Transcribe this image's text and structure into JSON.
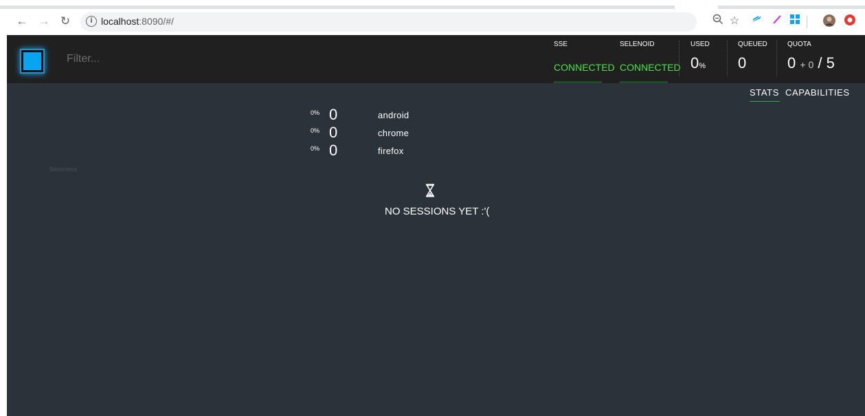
{
  "browser": {
    "url_host": "localhost",
    "url_path": ":8090/#/",
    "info_glyph": "i",
    "icons": [
      "back-icon",
      "forward-icon",
      "reload-icon",
      "zoom-icon",
      "bookmark-star-icon",
      "extension-feather-icon",
      "extension-pen-icon",
      "extension-windows-icon",
      "profile-avatar-icon",
      "extension-red-icon"
    ]
  },
  "app": {
    "filter_placeholder": "Filter...",
    "colors": {
      "background": "#2c323a",
      "topbar": "#202020",
      "connected": "#4be34b",
      "accent": "#09a4ef"
    },
    "stats": {
      "sse": {
        "label": "SSE",
        "value": "CONNECTED"
      },
      "selenoid": {
        "label": "SELENOID",
        "value": "CONNECTED"
      },
      "used": {
        "label": "USED",
        "value": "0",
        "unit": "%"
      },
      "queued": {
        "label": "QUEUED",
        "value": "0"
      },
      "quota": {
        "label": "QUOTA",
        "used": "0",
        "plus": "+ 0",
        "total": "/ 5"
      }
    },
    "tabs": [
      {
        "label": "STATS",
        "active": true
      },
      {
        "label": "CAPABILITIES",
        "active": false
      }
    ],
    "browsers": [
      {
        "pct": "0%",
        "count": "0",
        "name": "android"
      },
      {
        "pct": "0%",
        "count": "0",
        "name": "chrome"
      },
      {
        "pct": "0%",
        "count": "0",
        "name": "firefox"
      }
    ],
    "sessions_label": "Sessions",
    "empty_message": "NO SESSIONS YET :'("
  }
}
